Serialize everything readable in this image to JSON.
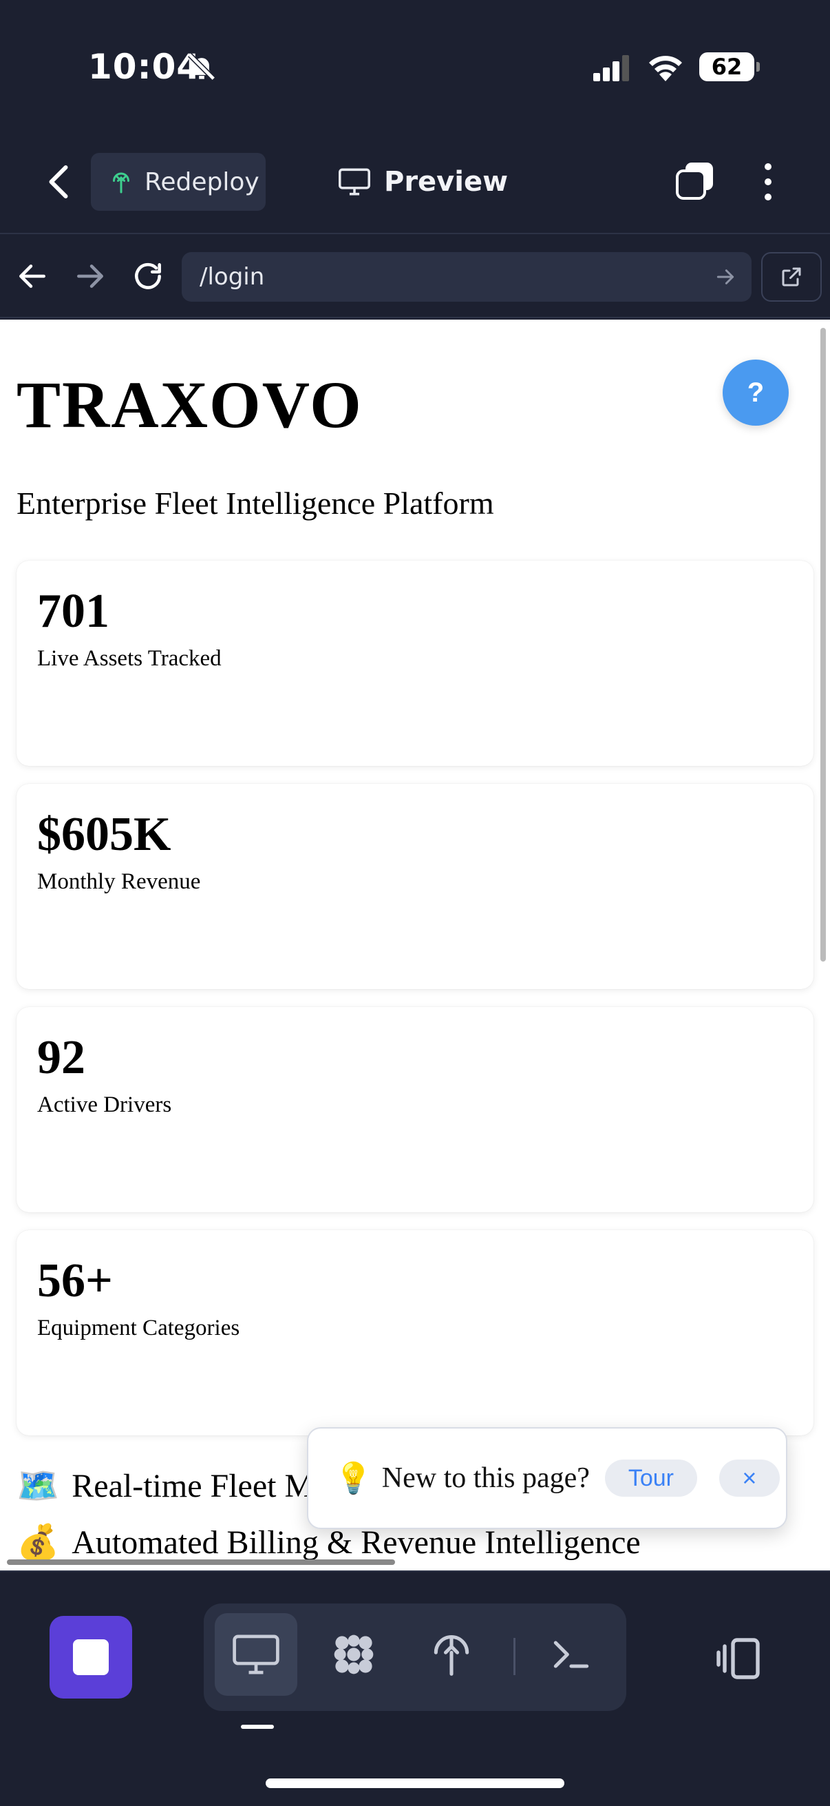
{
  "status_bar": {
    "time": "10:04",
    "battery": "62"
  },
  "header": {
    "redeploy_label": "Redeploy",
    "preview_label": "Preview"
  },
  "url_bar": {
    "url": "/login"
  },
  "page": {
    "brand": "TRAXOVO",
    "help_label": "?",
    "tagline": "Enterprise Fleet Intelligence Platform",
    "stats": [
      {
        "value": "701",
        "label": "Live Assets Tracked"
      },
      {
        "value": "$605K",
        "label": "Monthly Revenue"
      },
      {
        "value": "92",
        "label": "Active Drivers"
      },
      {
        "value": "56+",
        "label": "Equipment Categories"
      }
    ],
    "features": [
      {
        "emoji": "🗺️",
        "text": "Real-time Fleet M"
      },
      {
        "emoji": "💰",
        "text": "Automated Billing & Revenue Intelligence"
      }
    ]
  },
  "tour_popup": {
    "emoji": "💡",
    "question": "New to this page?",
    "tour_label": "Tour",
    "close_label": "×"
  },
  "colors": {
    "accent": "#5b3fd8",
    "help_blue": "#4a9af0",
    "tour_link": "#3b82f6",
    "chrome_bg": "#1c2030"
  }
}
